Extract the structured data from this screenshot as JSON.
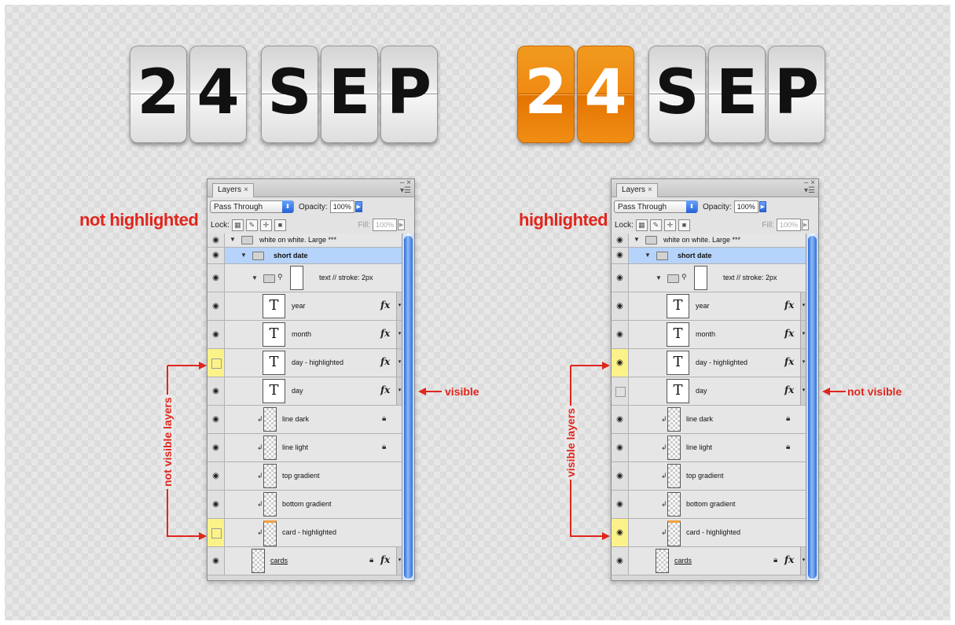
{
  "cards_left": [
    "2",
    "4",
    "S",
    "E",
    "P"
  ],
  "cards_right": [
    "2",
    "4",
    "S",
    "E",
    "P"
  ],
  "labels": {
    "not_highlighted": "not highlighted",
    "highlighted": "highlighted",
    "visible": "visible",
    "not_visible": "not visible",
    "not_visible_layers": "not visible layers",
    "visible_layers": "visible layers"
  },
  "panel": {
    "tab": "Layers",
    "tab_close": "×",
    "blend_mode": "Pass Through",
    "opacity_label": "Opacity:",
    "opacity_value": "100%",
    "lock_label": "Lock:",
    "fill_label": "Fill:",
    "fill_value": "100%"
  },
  "layers": [
    "white on white. Large ***",
    "short date",
    "text // stroke: 2px",
    "year",
    "month",
    "day - highlighted",
    "day",
    "line dark",
    "line light",
    "top gradient",
    "bottom gradient",
    "card - highlighted",
    "cards"
  ],
  "colors": {
    "accent_red": "#e0261d",
    "highlight_orange": "#f08a12",
    "selection_blue": "#b5d3fb",
    "marker_yellow": "#fbf38a"
  }
}
